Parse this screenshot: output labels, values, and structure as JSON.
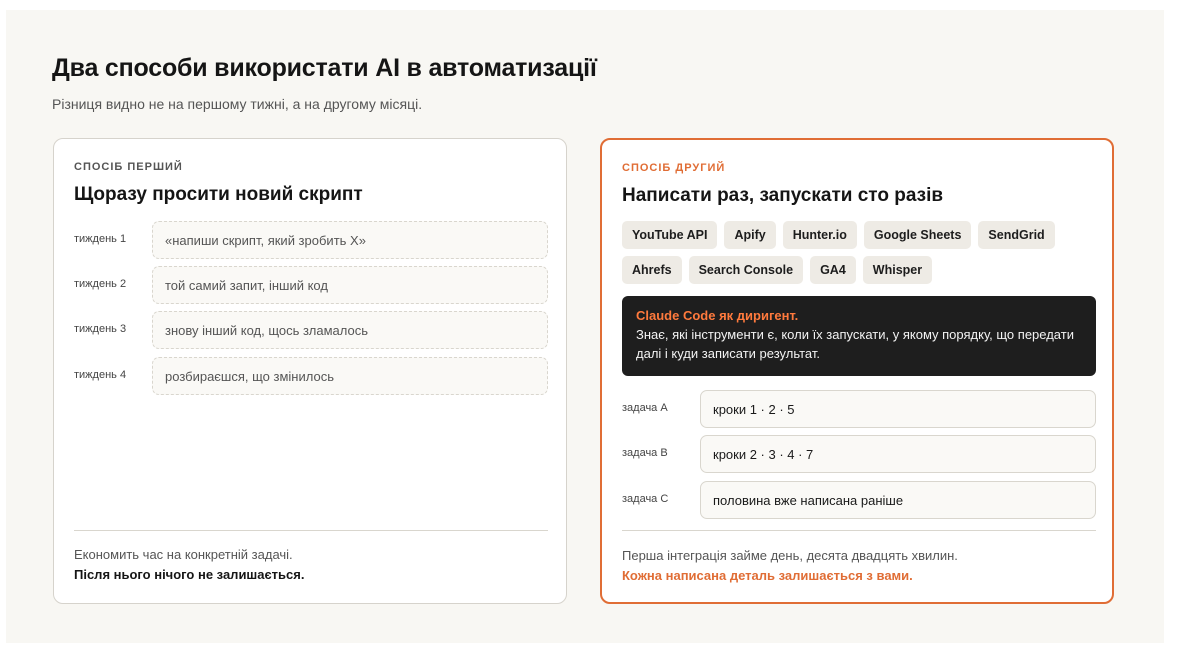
{
  "header": {
    "title": "Два способи використати AI в автоматизації",
    "subtitle": "Різниця видно не на першому тижні, а на другому місяці."
  },
  "left_card": {
    "eyebrow": "Спосіб перший",
    "title": "Щоразу просити новий скрипт",
    "weeks": [
      {
        "label": "тиждень 1",
        "text": "«напиши скрипт, який зробить X»"
      },
      {
        "label": "тиждень 2",
        "text": "той самий запит, інший код"
      },
      {
        "label": "тиждень 3",
        "text": "знову інший код, щось зламалось"
      },
      {
        "label": "тиждень 4",
        "text": "розбираєшся, що змінилось"
      }
    ],
    "footer_line1": "Економить час на конкретній задачі.",
    "footer_line2": "Після нього нічого не залишається."
  },
  "right_card": {
    "eyebrow": "Спосіб другий",
    "title": "Написати раз, запускати сто разів",
    "tags_row1": [
      "YouTube API",
      "Apify",
      "Hunter.io",
      "Google Sheets",
      "SendGrid"
    ],
    "tags_row2": [
      "Ahrefs",
      "Search Console",
      "GA4",
      "Whisper"
    ],
    "highlight": {
      "title": "Claude Code як диригент.",
      "text": "Знає, які інструменти є, коли їх запускати, у якому порядку, що передати далі і куди записати результат."
    },
    "tasks": [
      {
        "label": "задача A",
        "text": "кроки 1 · 2 · 5"
      },
      {
        "label": "задача B",
        "text": "кроки 2 · 3 · 4 · 7"
      },
      {
        "label": "задача C",
        "text": "половина вже написана раніше"
      }
    ],
    "footer_line1": "Перша інтеграція займе день, десята двадцять хвилин.",
    "footer_line2": "Кожна написана деталь залишається з вами."
  },
  "colors": {
    "accent": "#e06d35",
    "background": "#f8f7f3",
    "dark_box": "#1e1e1e"
  }
}
